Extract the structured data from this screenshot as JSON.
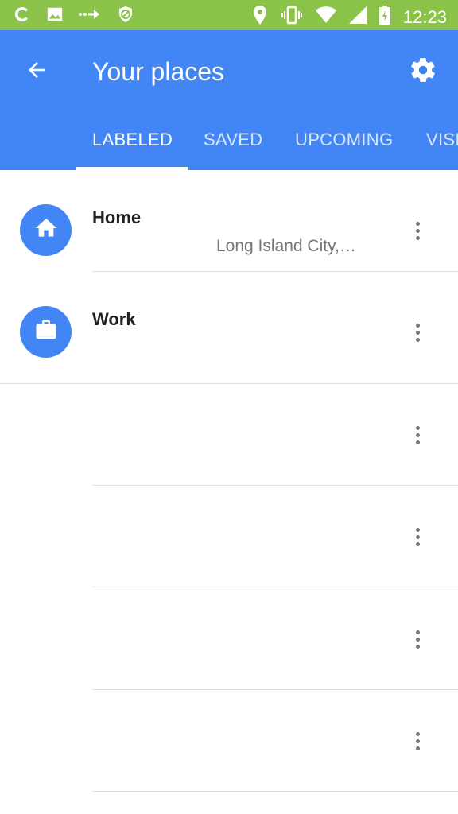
{
  "status_bar": {
    "time": "12:23",
    "left_icons": [
      "cyanogen-icon",
      "image-icon",
      "transfer-arrows-icon",
      "blocked-icon"
    ],
    "right_icons": [
      "location-pin-icon",
      "vibrate-icon",
      "wifi-icon",
      "signal-icon",
      "battery-charging-icon"
    ]
  },
  "app_bar": {
    "title": "Your places",
    "back_icon": "arrow-back-icon",
    "settings_icon": "gear-icon"
  },
  "tabs": [
    {
      "label": "LABELED",
      "active": true
    },
    {
      "label": "SAVED",
      "active": false
    },
    {
      "label": "UPCOMING",
      "active": false
    },
    {
      "label": "VISITED",
      "active": false
    }
  ],
  "places": [
    {
      "name": "Home",
      "address": "Long Island City,…",
      "icon": "home-icon"
    },
    {
      "name": "Work",
      "address": "",
      "icon": "briefcase-icon"
    }
  ],
  "empty_rows": 4,
  "colors": {
    "status_bar": "#8bc34a",
    "app_bar": "#4285f4",
    "accent": "#4285f4"
  }
}
